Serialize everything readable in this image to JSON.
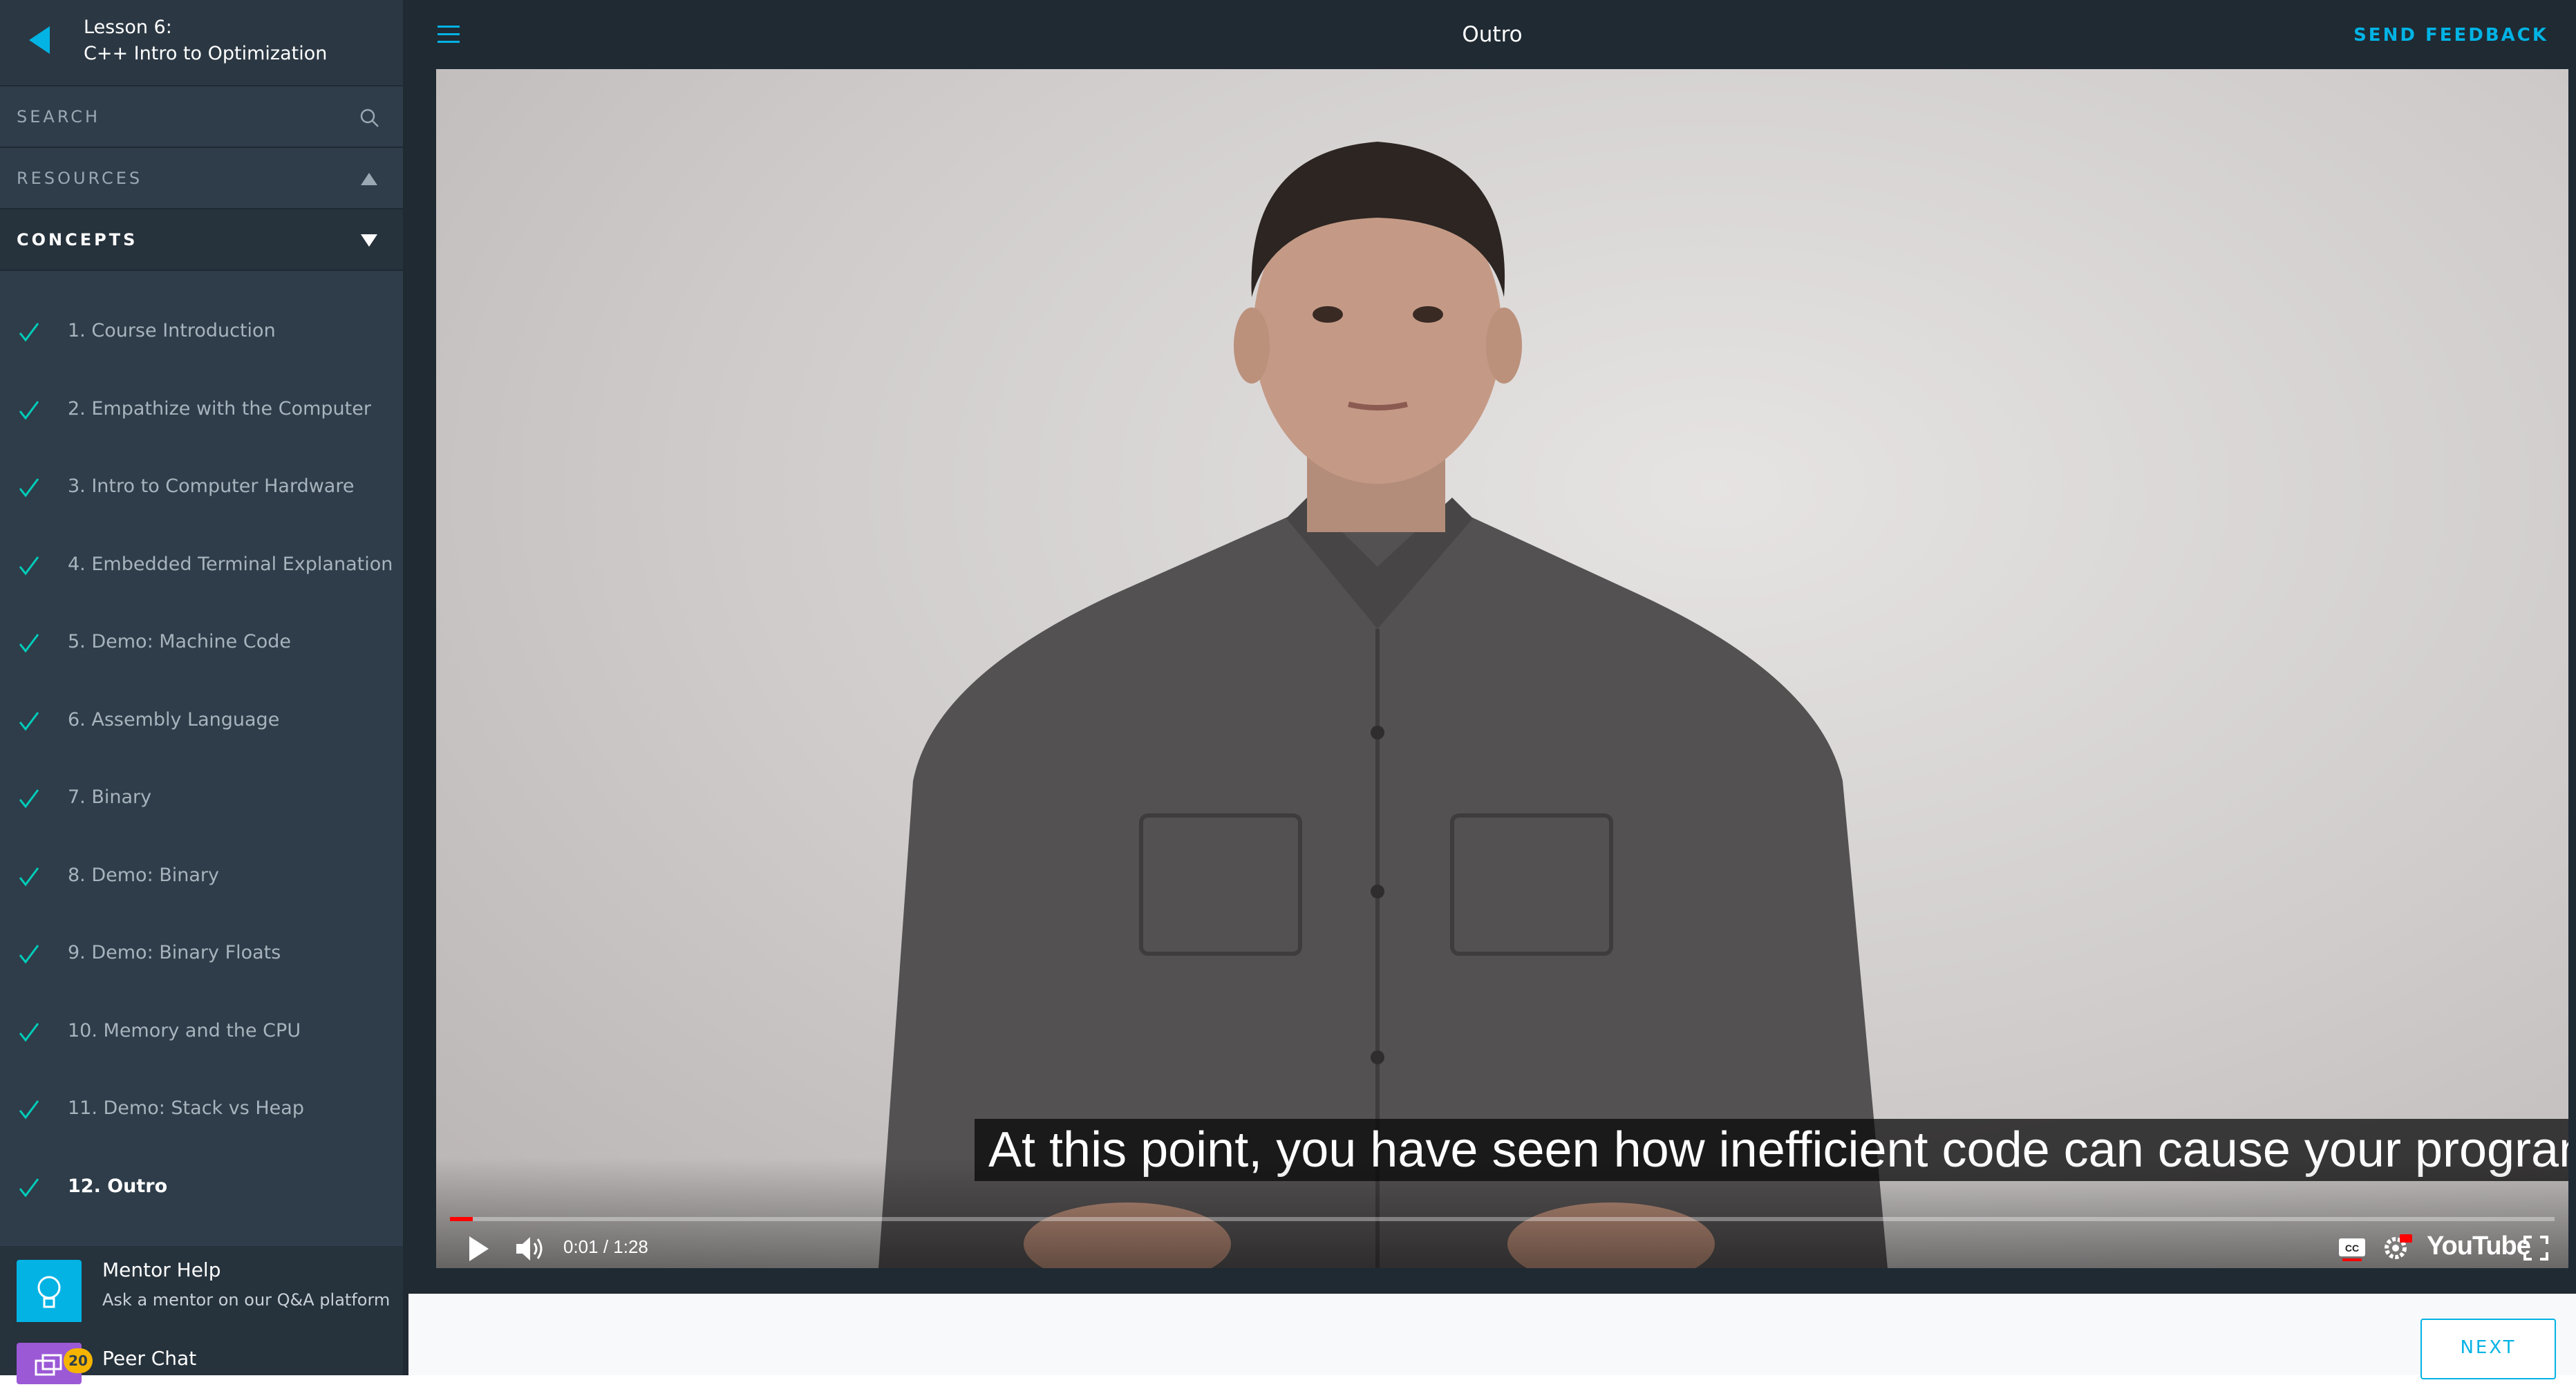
{
  "lesson": {
    "number": "Lesson 6:",
    "title": "C++ Intro to Optimization"
  },
  "sidebar": {
    "search_label": "SEARCH",
    "resources_label": "RESOURCES",
    "concepts_label": "CONCEPTS",
    "concepts": [
      {
        "label": "1. Course Introduction",
        "completed": true
      },
      {
        "label": "2. Empathize with the Computer",
        "completed": true
      },
      {
        "label": "3. Intro to Computer Hardware",
        "completed": true
      },
      {
        "label": "4. Embedded Terminal Explanation",
        "completed": true
      },
      {
        "label": "5. Demo: Machine Code",
        "completed": true
      },
      {
        "label": "6. Assembly Language",
        "completed": true
      },
      {
        "label": "7. Binary",
        "completed": true
      },
      {
        "label": "8. Demo: Binary",
        "completed": true
      },
      {
        "label": "9. Demo: Binary Floats",
        "completed": true
      },
      {
        "label": "10. Memory and the CPU",
        "completed": true
      },
      {
        "label": "11. Demo: Stack vs Heap",
        "completed": true
      },
      {
        "label": "12. Outro",
        "completed": true,
        "active": true
      }
    ],
    "mentor": {
      "title": "Mentor Help",
      "subtitle": "Ask a mentor on our Q&A platform"
    },
    "peer": {
      "title": "Peer Chat",
      "badge": "20"
    }
  },
  "header": {
    "title": "Outro",
    "feedback_label": "SEND FEEDBACK"
  },
  "video": {
    "caption": "At this point, you have seen how inefficient code can cause your program to slow",
    "current_time": "0:01",
    "separator": " / ",
    "duration": "1:28",
    "progress_fraction": 0.011,
    "brand": "YouTube"
  },
  "footer": {
    "next_label": "NEXT"
  },
  "colors": {
    "accent": "#02b3e4",
    "sidebar_bg": "#2e3d49",
    "topbar_bg": "#1f2a33",
    "check": "#02ccba",
    "progress": "#ff0000"
  }
}
